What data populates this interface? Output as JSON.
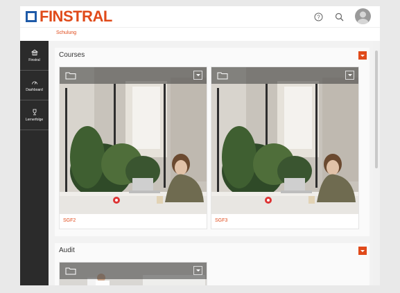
{
  "header": {
    "logo_text": "FINSTRAL",
    "help_icon": "help-circle-icon",
    "search_icon": "search-icon",
    "avatar_icon": "user-avatar-icon"
  },
  "subnav": {
    "label": "Schulung"
  },
  "sidebar": {
    "items": [
      {
        "label": "Finstral",
        "icon": "building-icon"
      },
      {
        "label": "Dashboard",
        "icon": "dashboard-icon"
      },
      {
        "label": "Lernerfolge",
        "icon": "trophy-icon"
      }
    ]
  },
  "sections": {
    "courses": {
      "title": "Courses",
      "cards": [
        {
          "name": "SGF2"
        },
        {
          "name": "SGF3"
        }
      ]
    },
    "audit": {
      "title": "Audit"
    }
  },
  "colors": {
    "accent": "#e04a1a",
    "brand_blue": "#1e5aa8",
    "sidebar": "#2b2b2b"
  }
}
